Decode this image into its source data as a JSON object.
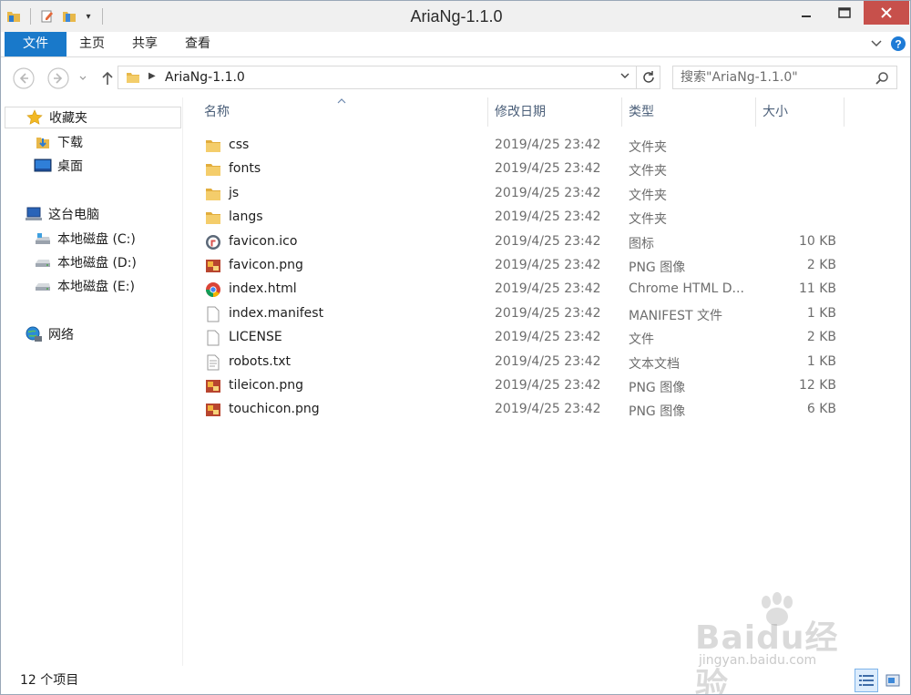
{
  "window": {
    "title": "AriaNg-1.1.0"
  },
  "ribbon": {
    "tabs": [
      "文件",
      "主页",
      "共享",
      "查看"
    ]
  },
  "address": {
    "crumbs": [
      "AriaNg-1.1.0"
    ]
  },
  "search": {
    "placeholder": "搜索\"AriaNg-1.1.0\""
  },
  "navpane": {
    "favorites": {
      "label": "收藏夹",
      "items": [
        "下载",
        "桌面"
      ]
    },
    "thispc": {
      "label": "这台电脑",
      "items": [
        "本地磁盘 (C:)",
        "本地磁盘 (D:)",
        "本地磁盘 (E:)"
      ]
    },
    "network": {
      "label": "网络"
    }
  },
  "columns": {
    "name": "名称",
    "date": "修改日期",
    "type": "类型",
    "size": "大小"
  },
  "files": [
    {
      "name": "css",
      "date": "2019/4/25 23:42",
      "type": "文件夹",
      "size": "",
      "icon": "folder-icon"
    },
    {
      "name": "fonts",
      "date": "2019/4/25 23:42",
      "type": "文件夹",
      "size": "",
      "icon": "folder-icon"
    },
    {
      "name": "js",
      "date": "2019/4/25 23:42",
      "type": "文件夹",
      "size": "",
      "icon": "folder-icon"
    },
    {
      "name": "langs",
      "date": "2019/4/25 23:42",
      "type": "文件夹",
      "size": "",
      "icon": "folder-icon"
    },
    {
      "name": "favicon.ico",
      "date": "2019/4/25 23:42",
      "type": "图标",
      "size": "10 KB",
      "icon": "ico-file-icon"
    },
    {
      "name": "favicon.png",
      "date": "2019/4/25 23:42",
      "type": "PNG 图像",
      "size": "2 KB",
      "icon": "png-file-icon"
    },
    {
      "name": "index.html",
      "date": "2019/4/25 23:42",
      "type": "Chrome HTML D...",
      "size": "11 KB",
      "icon": "chrome-html-icon"
    },
    {
      "name": "index.manifest",
      "date": "2019/4/25 23:42",
      "type": "MANIFEST 文件",
      "size": "1 KB",
      "icon": "blank-file-icon"
    },
    {
      "name": "LICENSE",
      "date": "2019/4/25 23:42",
      "type": "文件",
      "size": "2 KB",
      "icon": "blank-file-icon"
    },
    {
      "name": "robots.txt",
      "date": "2019/4/25 23:42",
      "type": "文本文档",
      "size": "1 KB",
      "icon": "text-file-icon"
    },
    {
      "name": "tileicon.png",
      "date": "2019/4/25 23:42",
      "type": "PNG 图像",
      "size": "12 KB",
      "icon": "png-file-icon"
    },
    {
      "name": "touchicon.png",
      "date": "2019/4/25 23:42",
      "type": "PNG 图像",
      "size": "6 KB",
      "icon": "png-file-icon"
    }
  ],
  "status": {
    "count": "12 个项目"
  },
  "watermark": {
    "brand": "Baidu经验",
    "url": "jingyan.baidu.com"
  },
  "colors": {
    "file_tab": "#1979ca",
    "close_button": "#c7504b",
    "header_text": "#4c607a"
  }
}
